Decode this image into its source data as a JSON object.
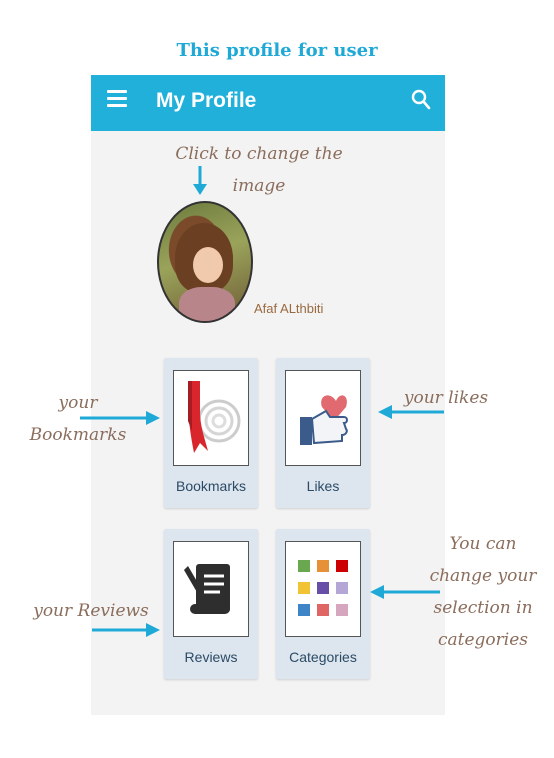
{
  "page_title": "This profile for user",
  "colors": {
    "accent": "#1fa9d6",
    "appbar": "#20b0da",
    "card": "#dde6ee",
    "annotation": "#8a6d5c"
  },
  "app": {
    "menu_icon": "hamburger-menu-icon",
    "title": "My Profile",
    "search_icon": "search-icon"
  },
  "profile": {
    "user_name": "Afaf ALthbiti"
  },
  "cards": [
    {
      "label": "Bookmarks",
      "icon": "bookmark-ribbon-icon"
    },
    {
      "label": "Likes",
      "icon": "thumbs-up-heart-icon"
    },
    {
      "label": "Reviews",
      "icon": "scroll-pen-icon"
    },
    {
      "label": "Categories",
      "icon": "category-grid-icon"
    }
  ],
  "annotations": {
    "change_image": [
      "Click to change the",
      "image"
    ],
    "bookmarks": [
      "your",
      "Bookmarks"
    ],
    "likes": "your likes",
    "reviews": "your Reviews",
    "categories": [
      "You can",
      "change your",
      "selection in",
      "categories"
    ]
  }
}
